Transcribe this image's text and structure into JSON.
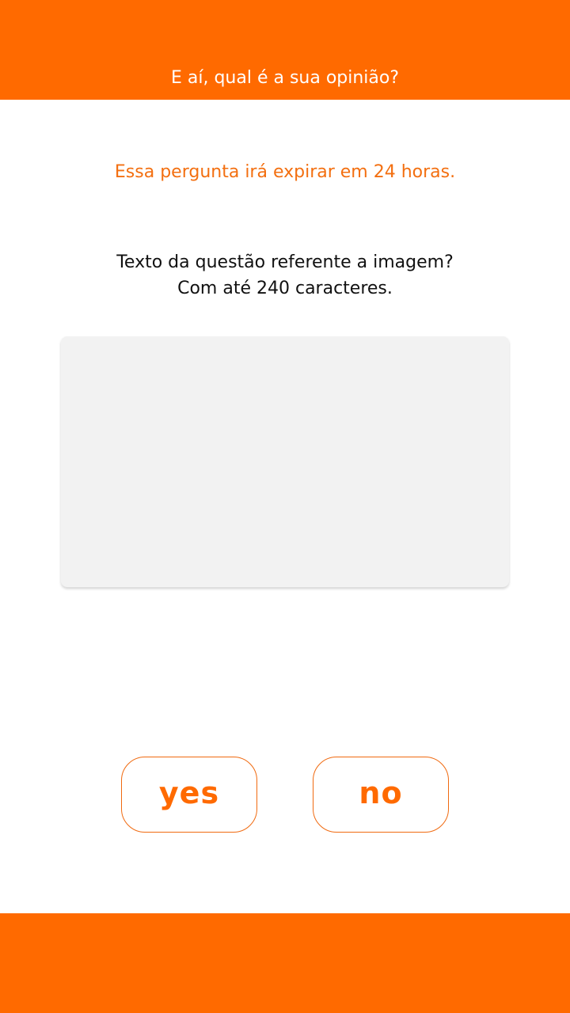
{
  "colors": {
    "brand": "#ff6a00",
    "image_placeholder": "#f2f2f2"
  },
  "header": {
    "title": "E aí, qual é a sua opinião?"
  },
  "main": {
    "expiry_notice": "Essa pergunta irá expirar em 24 horas.",
    "question_line1": "Texto da questão referente a imagem?",
    "question_line2": "Com até 240 caracteres."
  },
  "actions": {
    "yes_label": "yes",
    "no_label": "no"
  }
}
